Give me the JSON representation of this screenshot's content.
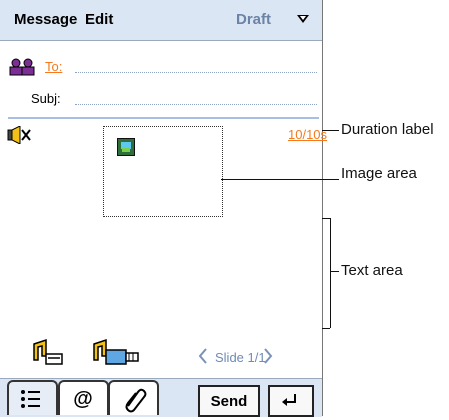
{
  "menu": {
    "message": "Message",
    "edit": "Edit",
    "draft": "Draft"
  },
  "fields": {
    "to_label": "To:",
    "subj_label": "Subj:"
  },
  "slide": {
    "duration": "10/10s",
    "label": "Slide 1/1"
  },
  "toolbar": {
    "send_label": "Send"
  },
  "annotations": {
    "duration": "Duration label",
    "image": "Image area",
    "text": "Text area"
  },
  "colors": {
    "menu_bg": "#dbe6f4",
    "accent": "#f47a1d",
    "label_blue": "#6b83a5"
  }
}
